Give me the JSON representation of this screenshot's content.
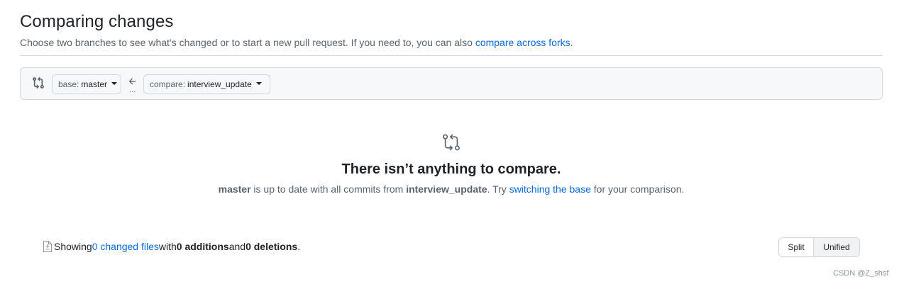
{
  "header": {
    "title": "Comparing changes",
    "desc_prefix": "Choose two branches to see what’s changed or to start a new pull request. If you need to, you can also ",
    "desc_link": "compare across forks",
    "desc_suffix": "."
  },
  "range": {
    "base_label": "base:",
    "base_value": "master",
    "compare_label": "compare:",
    "compare_value": "interview_update",
    "dots": "..."
  },
  "blankslate": {
    "title": "There isn’t anything to compare.",
    "branch_a": "master",
    "text_mid": " is up to date with all commits from ",
    "branch_b": "interview_update",
    "text_try": ". Try ",
    "link": "switching the base",
    "text_end": " for your comparison."
  },
  "toc": {
    "showing": "Showing ",
    "changed_files": "0 changed files",
    "with": " with ",
    "additions": "0 additions",
    "and": " and ",
    "deletions": "0 deletions",
    "period": "."
  },
  "view_toggle": {
    "split": "Split",
    "unified": "Unified",
    "selected": "Unified"
  },
  "watermark": "CSDN @Z_shsf",
  "colors": {
    "link": "#0969da",
    "border": "#d1d9e0",
    "muted": "#59636e"
  }
}
